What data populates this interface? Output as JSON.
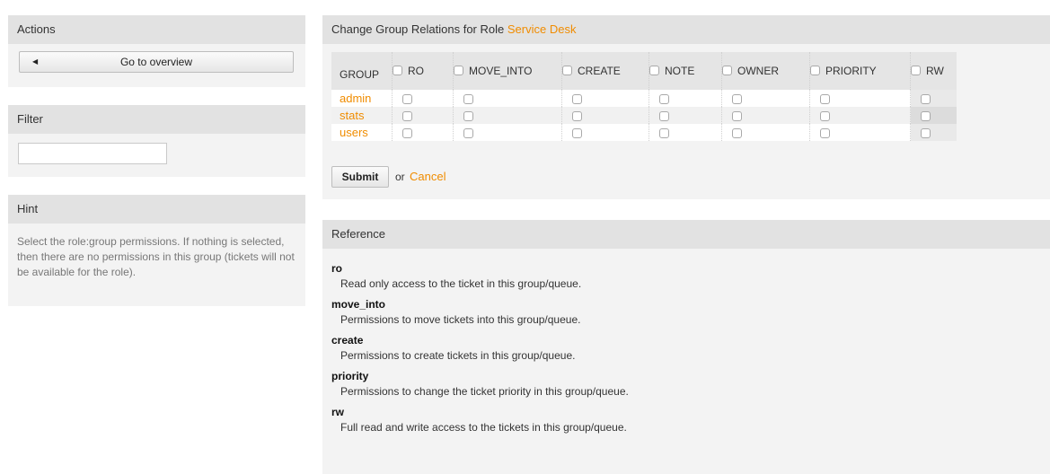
{
  "sidebar": {
    "actions": {
      "title": "Actions",
      "go_to_overview": "Go to overview"
    },
    "filter": {
      "title": "Filter",
      "value": "",
      "placeholder": ""
    },
    "hint": {
      "title": "Hint",
      "text": "Select the role:group permissions. If nothing is selected, then there are no permissions in this group (tickets will not be available for the role)."
    }
  },
  "main": {
    "title_prefix": "Change Group Relations for Role",
    "role_name": "Service Desk",
    "columns": [
      "GROUP",
      "RO",
      "MOVE_INTO",
      "CREATE",
      "NOTE",
      "OWNER",
      "PRIORITY",
      "RW"
    ],
    "rows": [
      {
        "group": "admin"
      },
      {
        "group": "stats"
      },
      {
        "group": "users"
      }
    ],
    "submit_label": "Submit",
    "or_label": "or",
    "cancel_label": "Cancel"
  },
  "reference": {
    "title": "Reference",
    "items": [
      {
        "term": "ro",
        "desc": "Read only access to the ticket in this group/queue."
      },
      {
        "term": "move_into",
        "desc": "Permissions to move tickets into this group/queue."
      },
      {
        "term": "create",
        "desc": "Permissions to create tickets in this group/queue."
      },
      {
        "term": "priority",
        "desc": "Permissions to change the ticket priority in this group/queue."
      },
      {
        "term": "rw",
        "desc": "Full read and write access to the tickets in this group/queue."
      }
    ]
  },
  "colors": {
    "accent_link": "#f08c00",
    "panel_bg": "#f3f3f3",
    "header_bg": "#e2e2e2"
  },
  "icons": {
    "overview_button": "triangle-left-icon",
    "permission_toggle": "checkbox-icon"
  }
}
